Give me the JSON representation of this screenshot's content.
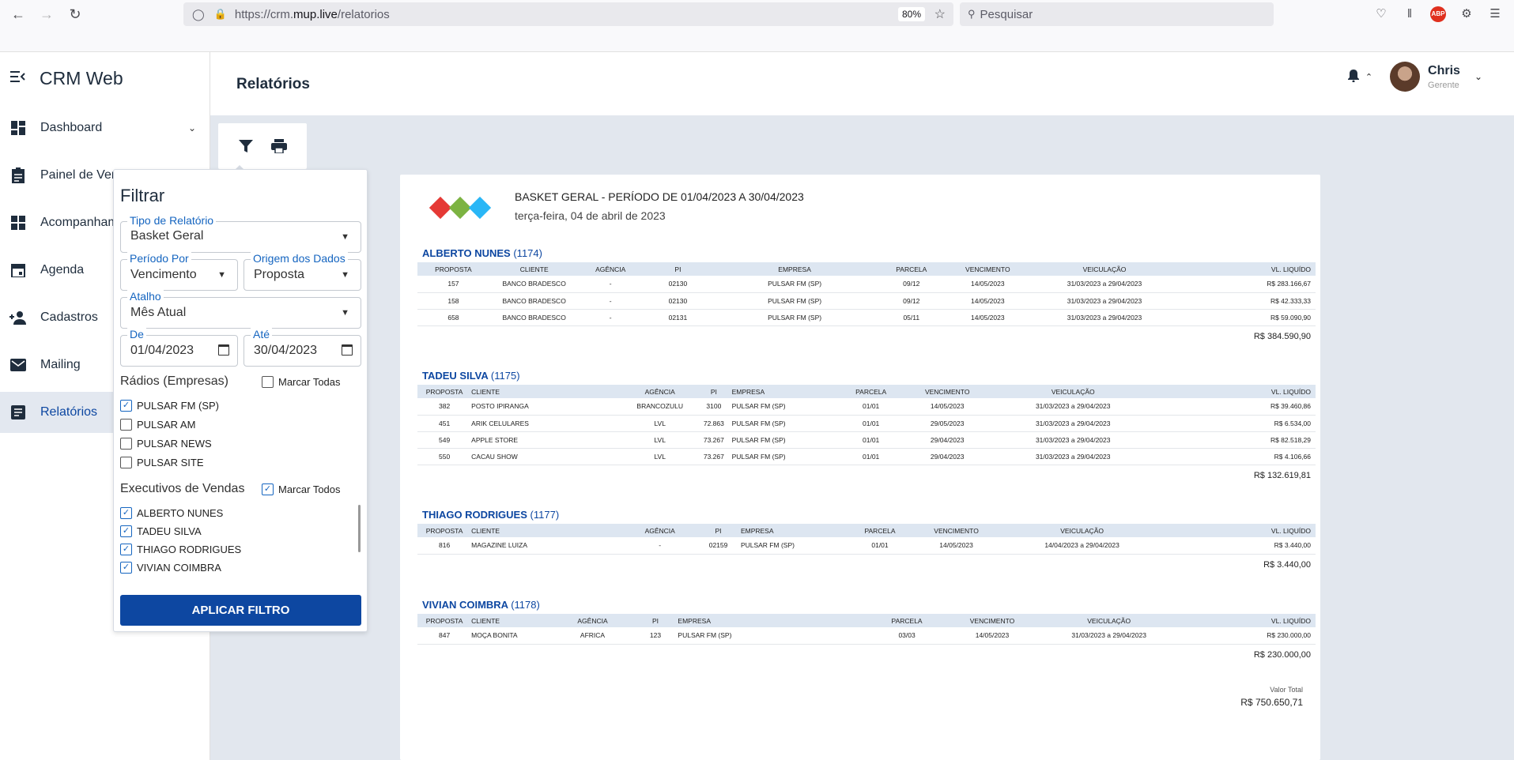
{
  "browser": {
    "url_scheme": "https://crm.",
    "url_host": "mup.live",
    "url_path": "/relatorios",
    "zoom": "80%",
    "search_placeholder": "Pesquisar"
  },
  "app": {
    "title": "CRM Web",
    "page_title": "Relatórios",
    "user_name": "Chris",
    "user_role": "Gerente"
  },
  "sidebar": {
    "items": [
      {
        "label": "Dashboard",
        "icon": "dashboard-icon"
      },
      {
        "label": "Painel de Vendas",
        "icon": "clipboard-icon"
      },
      {
        "label": "Acompanhamento",
        "icon": "grid-icon"
      },
      {
        "label": "Agenda",
        "icon": "calendar-icon"
      },
      {
        "label": "Cadastros",
        "icon": "person-add-icon"
      },
      {
        "label": "Mailing",
        "icon": "mail-icon"
      },
      {
        "label": "Relatórios",
        "icon": "report-icon"
      }
    ]
  },
  "filter": {
    "title": "Filtrar",
    "tipo_label": "Tipo de Relatório",
    "tipo_value": "Basket Geral",
    "periodo_label": "Período Por",
    "periodo_value": "Vencimento",
    "origem_label": "Origem dos Dados",
    "origem_value": "Proposta",
    "atalho_label": "Atalho",
    "atalho_value": "Mês Atual",
    "de_label": "De",
    "de_value": "01/04/2023",
    "ate_label": "Até",
    "ate_value": "30/04/2023",
    "radios_label": "Rádios (Empresas)",
    "marcar_todas": "Marcar Todas",
    "radios": [
      {
        "label": "PULSAR FM (SP)",
        "checked": true
      },
      {
        "label": "PULSAR AM",
        "checked": false
      },
      {
        "label": "PULSAR NEWS",
        "checked": false
      },
      {
        "label": "PULSAR SITE",
        "checked": false
      }
    ],
    "exec_label": "Executivos de Vendas",
    "marcar_todos": "Marcar Todos",
    "executivos": [
      {
        "label": "ALBERTO NUNES",
        "checked": true
      },
      {
        "label": "TADEU SILVA",
        "checked": true
      },
      {
        "label": "THIAGO RODRIGUES",
        "checked": true
      },
      {
        "label": "VIVIAN COIMBRA",
        "checked": true
      }
    ],
    "apply": "APLICAR FILTRO"
  },
  "report": {
    "title": "BASKET GERAL - PERÍODO DE 01/04/2023 A 30/04/2023",
    "date": "terça-feira, 04 de abril de 2023",
    "columns": [
      "PROPOSTA",
      "CLIENTE",
      "AGÊNCIA",
      "PI",
      "EMPRESA",
      "PARCELA",
      "VENCIMENTO",
      "VEICULAÇÃO",
      "VL. LIQUÍDO"
    ],
    "executives": [
      {
        "name": "ALBERTO NUNES",
        "code": "(1174)",
        "rows": [
          [
            "157",
            "BANCO BRADESCO",
            "-",
            "02130",
            "PULSAR FM (SP)",
            "09/12",
            "14/05/2023",
            "31/03/2023 a 29/04/2023",
            "R$ 283.166,67"
          ],
          [
            "158",
            "BANCO BRADESCO",
            "-",
            "02130",
            "PULSAR FM (SP)",
            "09/12",
            "14/05/2023",
            "31/03/2023 a 29/04/2023",
            "R$ 42.333,33"
          ],
          [
            "658",
            "BANCO BRADESCO",
            "-",
            "02131",
            "PULSAR FM (SP)",
            "05/11",
            "14/05/2023",
            "31/03/2023 a 29/04/2023",
            "R$ 59.090,90"
          ]
        ],
        "subtotal": "R$ 384.590,90"
      },
      {
        "name": "TADEU SILVA",
        "code": "(1175)",
        "rows": [
          [
            "382",
            "POSTO IPIRANGA",
            "BRANCOZULU",
            "3100",
            "PULSAR FM (SP)",
            "01/01",
            "14/05/2023",
            "31/03/2023 a 29/04/2023",
            "R$ 39.460,86"
          ],
          [
            "451",
            "ARIK CELULARES",
            "LVL",
            "72.863",
            "PULSAR FM (SP)",
            "01/01",
            "29/05/2023",
            "31/03/2023 a 29/04/2023",
            "R$ 6.534,00"
          ],
          [
            "549",
            "APPLE STORE",
            "LVL",
            "73.267",
            "PULSAR FM (SP)",
            "01/01",
            "29/04/2023",
            "31/03/2023 a 29/04/2023",
            "R$ 82.518,29"
          ],
          [
            "550",
            "CACAU SHOW",
            "LVL",
            "73.267",
            "PULSAR FM (SP)",
            "01/01",
            "29/04/2023",
            "31/03/2023 a 29/04/2023",
            "R$ 4.106,66"
          ]
        ],
        "subtotal": "R$ 132.619,81"
      },
      {
        "name": "THIAGO RODRIGUES",
        "code": "(1177)",
        "rows": [
          [
            "816",
            "MAGAZINE LUIZA",
            "-",
            "02159",
            "PULSAR FM (SP)",
            "01/01",
            "14/05/2023",
            "14/04/2023 a 29/04/2023",
            "R$ 3.440,00"
          ]
        ],
        "subtotal": "R$ 3.440,00"
      },
      {
        "name": "VIVIAN COIMBRA",
        "code": "(1178)",
        "rows": [
          [
            "847",
            "MOÇA BONITA",
            "AFRICA",
            "123",
            "PULSAR FM (SP)",
            "03/03",
            "14/05/2023",
            "31/03/2023 a 29/04/2023",
            "R$ 230.000,00"
          ]
        ],
        "subtotal": "R$ 230.000,00"
      }
    ],
    "total_label": "Valor Total",
    "total_value": "R$ 750.650,71"
  }
}
